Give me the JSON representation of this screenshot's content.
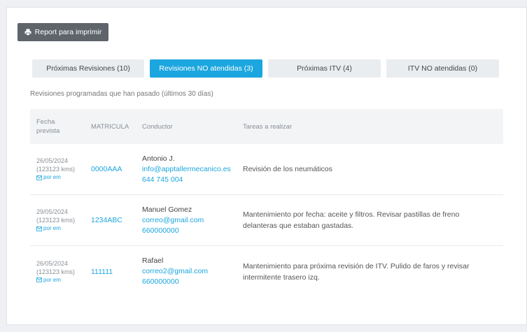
{
  "toolbar": {
    "print_label": "Report para imprimir"
  },
  "tabs": [
    {
      "label": "Próximas Revisiones (10)",
      "active": false
    },
    {
      "label": "Revisiones NO atendidas (3)",
      "active": true
    },
    {
      "label": "Próximas ITV (4)",
      "active": false
    },
    {
      "label": "ITV NO atendidas (0)",
      "active": false
    }
  ],
  "subtitle": "Revisiones programadas que han pasado (últimos 30 días)",
  "table": {
    "headers": {
      "date_line1": "Fecha",
      "date_line2": "prevista",
      "plate": "MATRICULA",
      "driver": "Conductor",
      "tasks": "Tareas a realizar"
    },
    "email_label": "por em",
    "rows": [
      {
        "date": "26/05/2024",
        "km": "(123123 kms)",
        "plate": "0000AAA",
        "name": "Antonio J.",
        "email": "info@apptallermecanico.es",
        "phone": "644 745 004",
        "task": "Revisión de los neumáticos"
      },
      {
        "date": "29/05/2024",
        "km": "(123123 kms)",
        "plate": "1234ABC",
        "name": "Manuel Gomez",
        "email": "correo@gmail.com",
        "phone": "660000000",
        "task": "Mantenimiento por fecha: aceite y filtros. Revisar pastillas de freno delanteras que estaban gastadas."
      },
      {
        "date": "26/05/2024",
        "km": "(123123 kms)",
        "plate": "111111",
        "name": "Rafael",
        "email": "correo2@gmail.com",
        "phone": "660000000",
        "task": "Mantenimiento para próxima revisión de ITV. Pulido de faros y revisar intermitente trasero izq."
      }
    ]
  },
  "colors": {
    "accent": "#1ca6df",
    "button": "#5f646b",
    "tab_bg": "#eaedf0",
    "header_bg": "#f2f4f6"
  }
}
